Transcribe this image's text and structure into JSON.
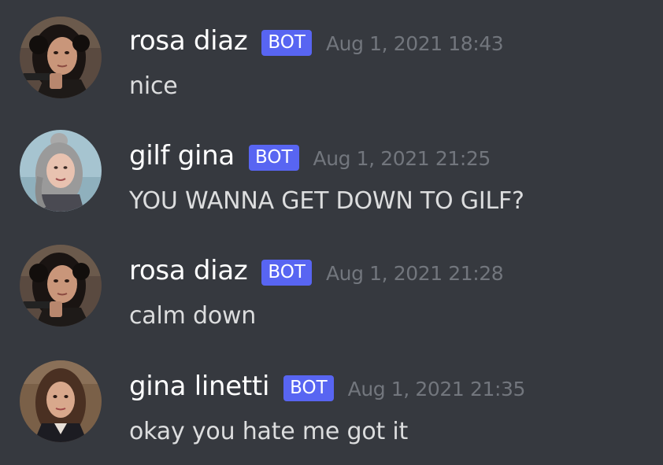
{
  "messages": [
    {
      "username": "rosa diaz",
      "badge": "BOT",
      "timestamp": "Aug 1, 2021 18:43",
      "content": "nice",
      "avatar_icon": "woman-dark-curly-hair-holding-gun"
    },
    {
      "username": "gilf gina",
      "badge": "BOT",
      "timestamp": "Aug 1, 2021 21:25",
      "content": "YOU WANNA GET DOWN TO GILF?",
      "avatar_icon": "elderly-woman-gray-hair-bun"
    },
    {
      "username": "rosa diaz",
      "badge": "BOT",
      "timestamp": "Aug 1, 2021 21:28",
      "content": "calm down",
      "avatar_icon": "woman-dark-curly-hair-holding-gun"
    },
    {
      "username": "gina linetti",
      "badge": "BOT",
      "timestamp": "Aug 1, 2021 21:35",
      "content": "okay you hate me got it",
      "avatar_icon": "woman-brown-wavy-hair"
    }
  ],
  "colors": {
    "background": "#36393f",
    "username": "#ffffff",
    "bot_badge": "#5865f2",
    "timestamp": "#72767d",
    "message_text": "#dcddde"
  }
}
